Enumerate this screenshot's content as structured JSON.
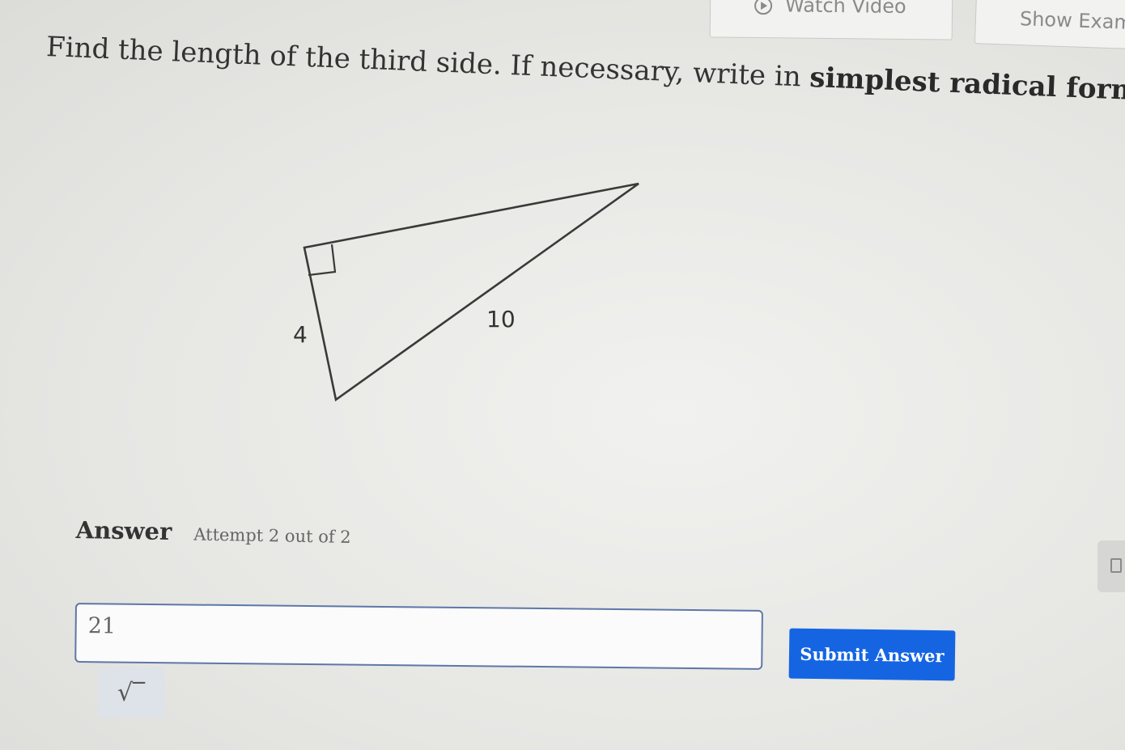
{
  "toolbar": {
    "watch_video_label": "Watch Video",
    "show_example_label": "Show Exam"
  },
  "question": {
    "prefix": "Find the length of the third side. If necessary, write in ",
    "emphasis": "simplest radical form",
    "suffix": "."
  },
  "figure": {
    "leg_label": "4",
    "hypotenuse_label": "10"
  },
  "answer": {
    "title": "Answer",
    "attempt": "Attempt 2 out of 2",
    "input_value": "21",
    "submit_label": "Submit Answer",
    "sqrt_symbol": "√‾"
  },
  "colors": {
    "submit_blue": "#1565e3",
    "input_border": "#5e77a8",
    "sqrt_button_bg": "#dde3e8"
  }
}
